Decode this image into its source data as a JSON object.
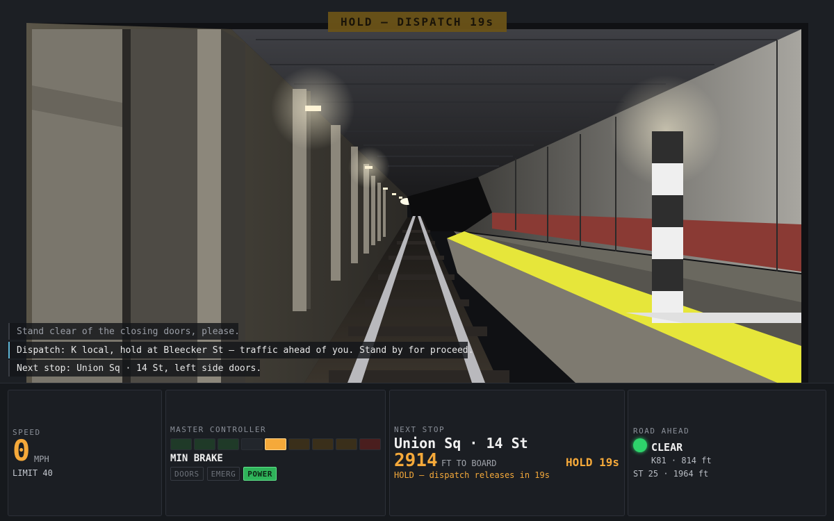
{
  "banner": {
    "text": "HOLD — DISPATCH 19s"
  },
  "messages": [
    {
      "text": "Stand clear of the closing doors, please."
    },
    {
      "text": "Dispatch: K local, hold at Bleecker St — traffic ahead of you. Stand by for proceed."
    },
    {
      "text": "Next stop: Union Sq · 14 St, left side doors."
    }
  ],
  "speed": {
    "label": "SPEED",
    "value": "0",
    "unit": "MPH",
    "limit": "LIMIT 40"
  },
  "controller": {
    "label": "MASTER CONTROLLER",
    "state": "MIN BRAKE",
    "notch_colors": [
      "#1f3a28",
      "#1f3a28",
      "#1f3a28",
      "#22262c",
      "#f5a93a",
      "#3a2f1a",
      "#3a2f1a",
      "#3a2f1a",
      "#4a1e1e"
    ],
    "selected_notch": 4,
    "buttons": [
      {
        "label": "DOORS",
        "active": false
      },
      {
        "label": "EMERG",
        "active": false
      },
      {
        "label": "POWER",
        "active": true
      }
    ]
  },
  "next_stop": {
    "label": "NEXT STOP",
    "name": "Union Sq · 14 St",
    "distance": "2914",
    "distance_unit": "FT TO BOARD",
    "hold": "HOLD 19s",
    "note": "HOLD — dispatch releases in 19s"
  },
  "road_ahead": {
    "label": "ROAD AHEAD",
    "state": "CLEAR",
    "signal_color": "#2ed36b",
    "train": "K81 · 814 ft",
    "next": "ST 25 · 1964 ft"
  },
  "colors": {
    "accent": "#f5a93a",
    "platform_edge": "#e6e63a",
    "clear": "#2ed36b",
    "wall_stripe": "#9a3a34"
  }
}
